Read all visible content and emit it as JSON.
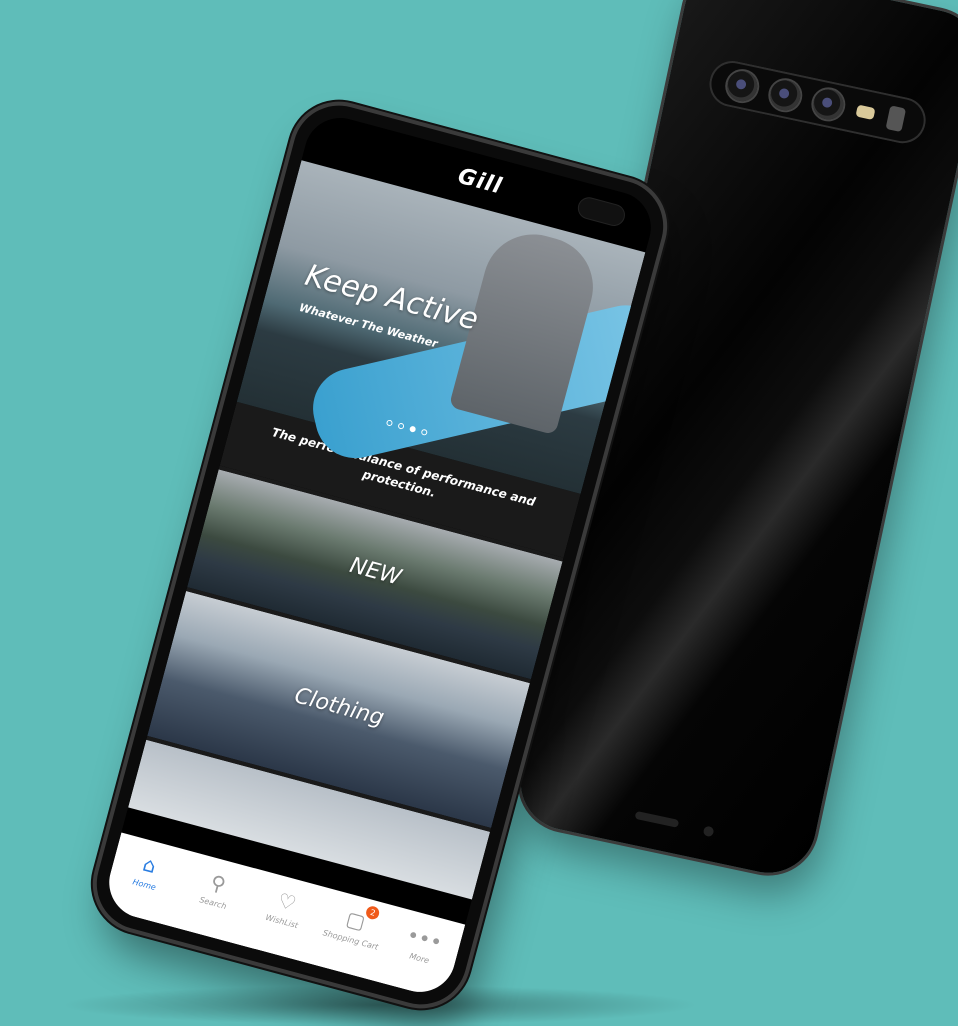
{
  "brand": {
    "logo_text": "Gill"
  },
  "hero": {
    "title": "Keep Active",
    "subtitle": "Whatever The Weather",
    "carousel": {
      "count": 4,
      "active_index": 2
    }
  },
  "tagline": "The perfect balance of performance and protection.",
  "tiles": [
    {
      "label": "NEW"
    },
    {
      "label": "Clothing"
    }
  ],
  "tabbar": {
    "items": [
      {
        "label": "Home",
        "icon": "home-icon",
        "active": true
      },
      {
        "label": "Search",
        "icon": "search-icon",
        "active": false
      },
      {
        "label": "WishList",
        "icon": "heart-icon",
        "active": false
      },
      {
        "label": "Shopping Cart",
        "icon": "shopping-bag-icon",
        "active": false,
        "badge": "2"
      },
      {
        "label": "More",
        "icon": "more-icon",
        "active": false
      }
    ]
  },
  "colors": {
    "background": "#5fbdb9",
    "accent": "#2a7de1",
    "badge": "#f05a1a"
  }
}
